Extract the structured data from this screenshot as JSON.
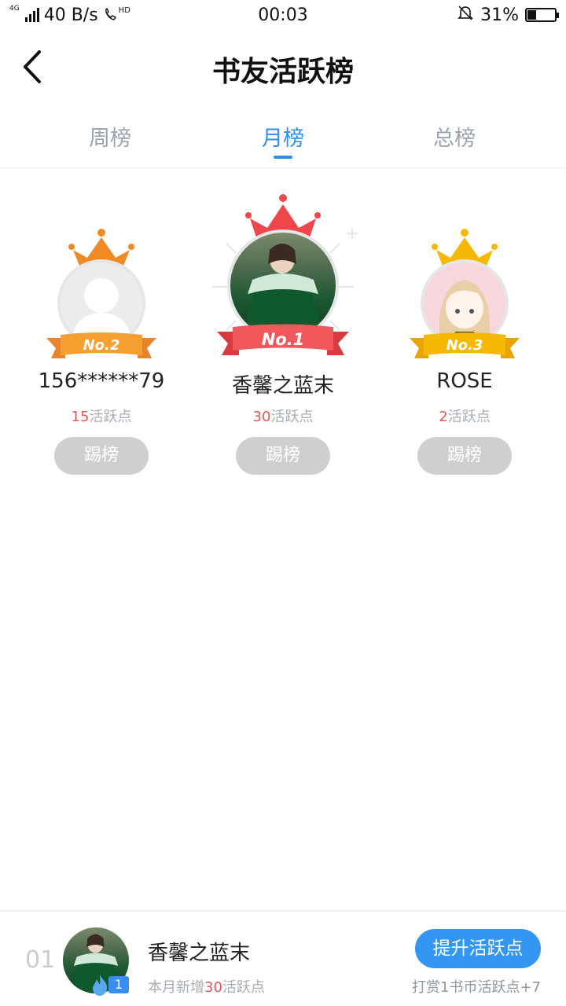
{
  "status_bar": {
    "network": "4G",
    "speed": "40 B/s",
    "hd_label": "HD",
    "time": "00:03",
    "battery_percent": "31%",
    "battery_level": 0.31
  },
  "header": {
    "title": "书友活跃榜"
  },
  "tabs": [
    {
      "label": "周榜",
      "active": false
    },
    {
      "label": "月榜",
      "active": true
    },
    {
      "label": "总榜",
      "active": false
    }
  ],
  "podium": [
    {
      "rank_label": "No.2",
      "name": "156******79",
      "points": "15",
      "points_suffix": "活跃点",
      "kick_label": "踢榜",
      "crown_color": "#f08a24",
      "ribbon_color": "#f5a030",
      "avatar": "default-user-icon"
    },
    {
      "rank_label": "No.1",
      "name": "香馨之蓝末",
      "points": "30",
      "points_suffix": "活跃点",
      "kick_label": "踢榜",
      "crown_color": "#f0474c",
      "ribbon_color": "#f0585c",
      "avatar": "photo-avatar"
    },
    {
      "rank_label": "No.3",
      "name": "ROSE",
      "points": "2",
      "points_suffix": "活跃点",
      "kick_label": "踢榜",
      "crown_color": "#f6b800",
      "ribbon_color": "#f6b800",
      "avatar": "anime-girl-avatar"
    }
  ],
  "bottom_bar": {
    "rank": "01",
    "name": "香馨之蓝末",
    "level": "1",
    "stat_prefix": "本月新增",
    "stat_value": "30",
    "stat_suffix": "活跃点",
    "boost_label": "提升活跃点",
    "reward_note": "打赏1书币活跃点+7"
  },
  "colors": {
    "accent": "#2f8ff0",
    "points_red": "#e05a5a",
    "button_gray": "#cfcfcf"
  }
}
